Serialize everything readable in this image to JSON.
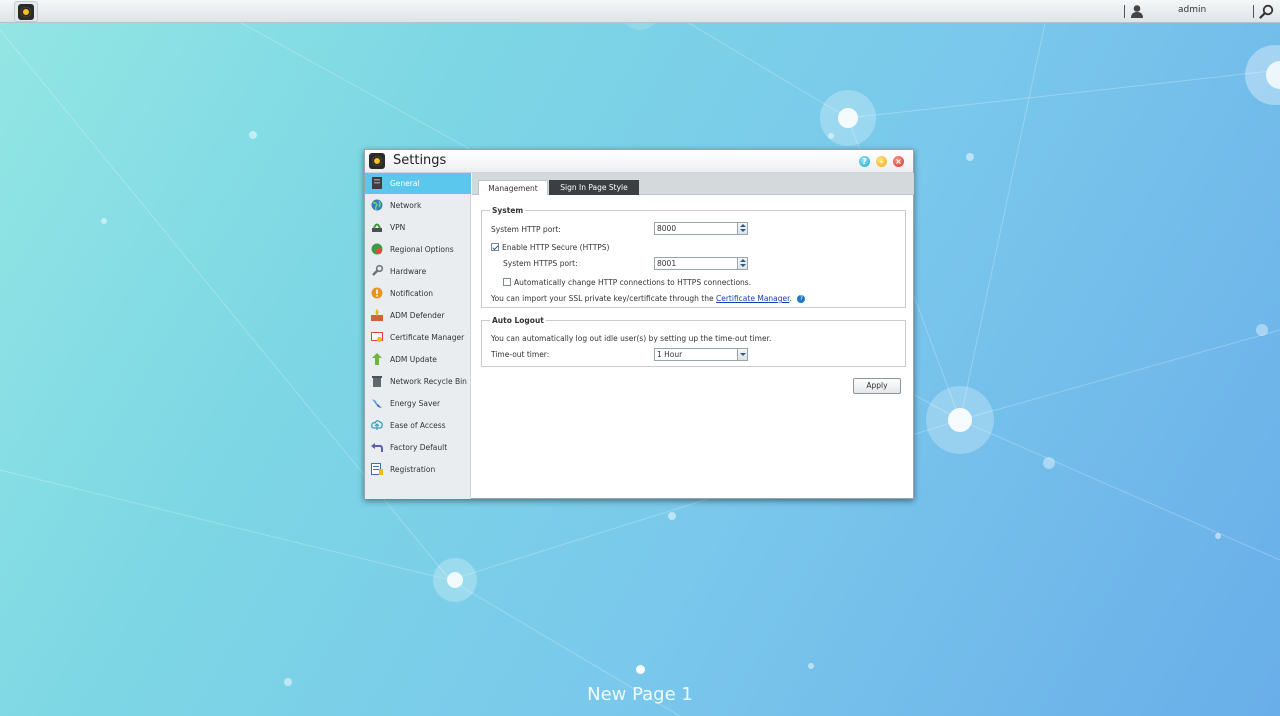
{
  "topbar": {
    "user_name": "admin"
  },
  "window": {
    "title": "Settings",
    "controls": {
      "help": "?",
      "minimize": "–",
      "close": "×"
    }
  },
  "sidebar": {
    "items": [
      {
        "label": "General",
        "icon": "server-icon",
        "active": true
      },
      {
        "label": "Network",
        "icon": "globe-icon"
      },
      {
        "label": "VPN",
        "icon": "vpn-icon"
      },
      {
        "label": "Regional Options",
        "icon": "regional-icon"
      },
      {
        "label": "Hardware",
        "icon": "wrench-icon"
      },
      {
        "label": "Notification",
        "icon": "alert-icon"
      },
      {
        "label": "ADM Defender",
        "icon": "firewall-icon"
      },
      {
        "label": "Certificate Manager",
        "icon": "certificate-icon"
      },
      {
        "label": "ADM Update",
        "icon": "up-arrow-icon"
      },
      {
        "label": "Network Recycle Bin",
        "icon": "trash-icon"
      },
      {
        "label": "Energy Saver",
        "icon": "energy-icon"
      },
      {
        "label": "Ease of Access",
        "icon": "cloud-icon"
      },
      {
        "label": "Factory Default",
        "icon": "undo-icon"
      },
      {
        "label": "Registration",
        "icon": "registration-icon"
      }
    ]
  },
  "tabs": {
    "management": "Management",
    "signin": "Sign In Page Style"
  },
  "system": {
    "title": "System",
    "http_port_label": "System HTTP port:",
    "http_port_value": "8000",
    "https_enable_label": "Enable HTTP Secure (HTTPS)",
    "https_port_label": "System HTTPS port:",
    "https_port_value": "8001",
    "auto_redirect_label": "Automatically change HTTP connections to HTTPS connections.",
    "import_text": "You can import your SSL private key/certificate through the",
    "import_link": "Certificate Manager",
    "import_end": "."
  },
  "auto_logout": {
    "title": "Auto Logout",
    "description": "You can automatically log out idle user(s) by setting up the time-out timer.",
    "timer_label": "Time-out timer:",
    "timer_value": "1 Hour"
  },
  "apply_label": "Apply",
  "page_label": "New Page 1",
  "colors": {
    "active_item": "#5bc7ec",
    "tab_dark": "#3b3f42",
    "link": "#1a3fb5"
  }
}
